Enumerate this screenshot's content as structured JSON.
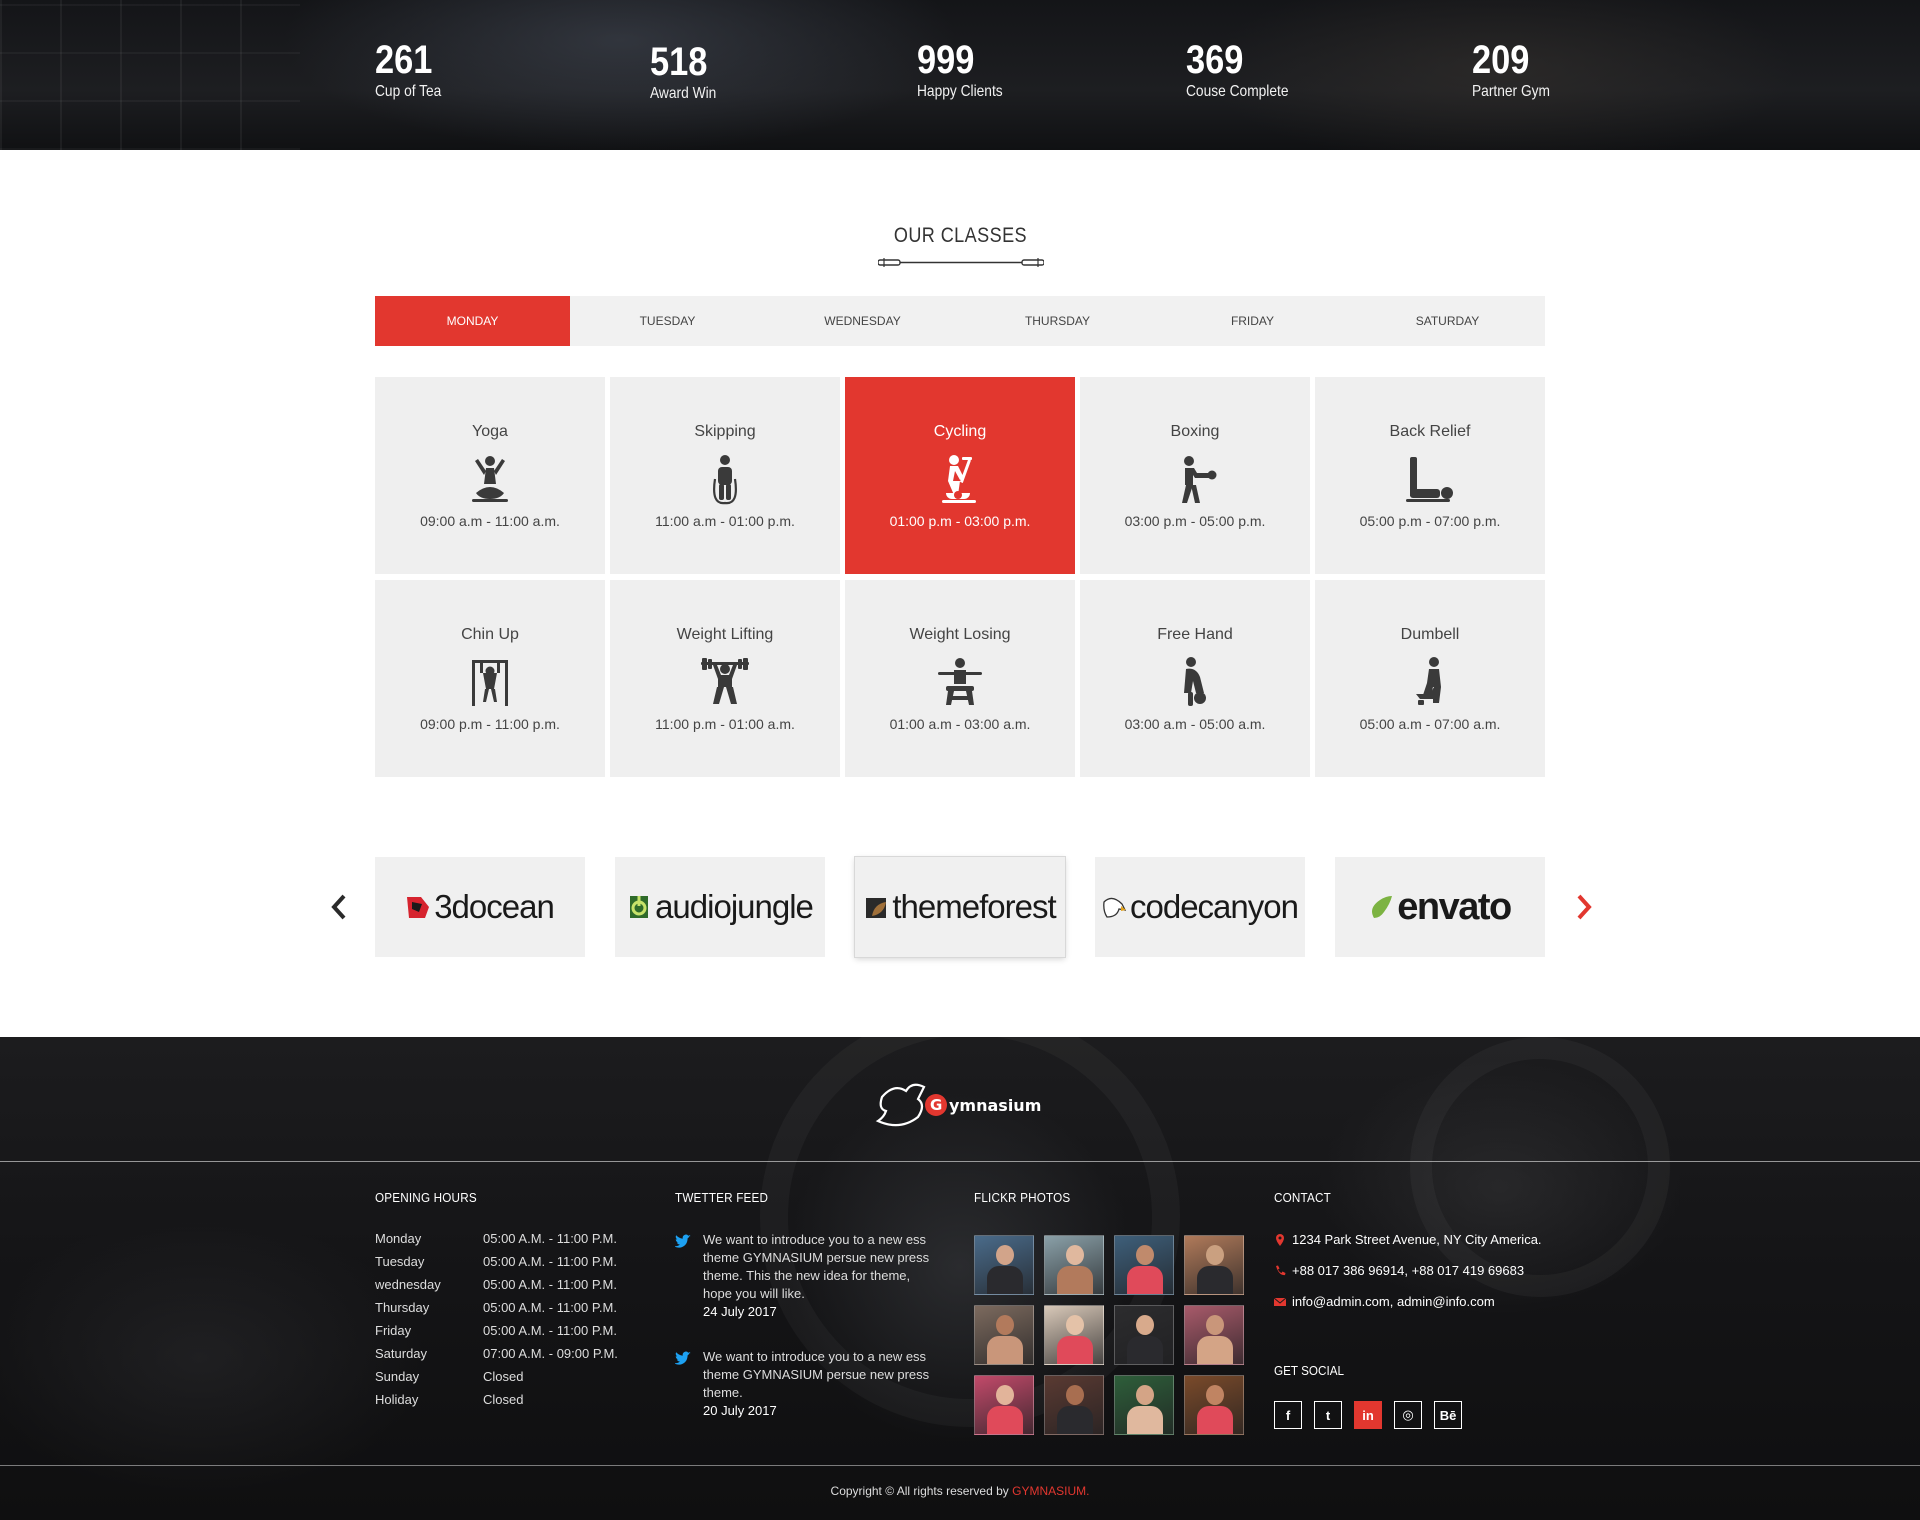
{
  "counters": [
    {
      "number": "261",
      "label": "Cup of Tea"
    },
    {
      "number": "518",
      "label": "Award Win"
    },
    {
      "number": "999",
      "label": "Happy Clients"
    },
    {
      "number": "369",
      "label": "Couse Complete"
    },
    {
      "number": "209",
      "label": "Partner Gym"
    }
  ],
  "classes_section": {
    "title": "OUR CLASSES",
    "tabs": [
      "MONDAY",
      "TUESDAY",
      "WEDNESDAY",
      "THURSDAY",
      "FRIDAY",
      "SATURDAY"
    ],
    "active_tab": "MONDAY",
    "classes": [
      {
        "name": "Yoga",
        "time": "09:00 a.m - 11:00 a.m.",
        "icon": "yoga-icon"
      },
      {
        "name": "Skipping",
        "time": "11:00 a.m - 01:00 p.m.",
        "icon": "skipping-icon"
      },
      {
        "name": "Cycling",
        "time": "01:00 p.m - 03:00 p.m.",
        "icon": "cycling-icon",
        "active": true
      },
      {
        "name": "Boxing",
        "time": "03:00 p.m - 05:00 p.m.",
        "icon": "boxing-icon"
      },
      {
        "name": "Back Relief",
        "time": "05:00 p.m - 07:00 p.m.",
        "icon": "back-relief-icon"
      },
      {
        "name": "Chin Up",
        "time": "09:00 p.m - 11:00 p.m.",
        "icon": "chin-up-icon"
      },
      {
        "name": "Weight Lifting",
        "time": "11:00 p.m - 01:00 a.m.",
        "icon": "weight-lifting-icon"
      },
      {
        "name": "Weight Losing",
        "time": "01:00 a.m - 03:00 a.m.",
        "icon": "weight-losing-icon"
      },
      {
        "name": "Free Hand",
        "time": "03:00 a.m - 05:00 a.m.",
        "icon": "free-hand-icon"
      },
      {
        "name": "Dumbell",
        "time": "05:00 a.m - 07:00 a.m.",
        "icon": "dumbell-icon"
      }
    ]
  },
  "partners": [
    {
      "name": "3docean",
      "color": "#d6232e"
    },
    {
      "name": "audiojungle",
      "color": "#2f6b2a"
    },
    {
      "name": "themeforest",
      "color": "#5c3d22"
    },
    {
      "name": "codecanyon",
      "color": "#ffffff"
    },
    {
      "name": "envato",
      "color": "#7cb342"
    }
  ],
  "footer": {
    "logo_text": "Gymnasium",
    "opening_hours": {
      "title": "OPENING HOURS",
      "rows": [
        {
          "day": "Monday",
          "time": "05:00 A.M. - 11:00 P.M."
        },
        {
          "day": "Tuesday",
          "time": "05:00 A.M. - 11:00 P.M."
        },
        {
          "day": "wednesday",
          "time": "05:00 A.M. - 11:00 P.M."
        },
        {
          "day": "Thursday",
          "time": "05:00 A.M. - 11:00 P.M."
        },
        {
          "day": "Friday",
          "time": "05:00 A.M. - 11:00 P.M."
        },
        {
          "day": "Saturday",
          "time": "07:00 A.M. - 09:00 P.M."
        },
        {
          "day": "Sunday",
          "time": "Closed"
        },
        {
          "day": "Holiday",
          "time": "Closed"
        }
      ]
    },
    "twitter_feed": {
      "title": "TWETTER FEED",
      "tweets": [
        {
          "text": "We want to introduce you to a new ess theme GYMNASIUM persue new press theme. This the new idea for theme, hope you will like.",
          "date": "24 July 2017"
        },
        {
          "text": "We want to introduce you to a new ess theme GYMNASIUM persue new press theme.",
          "date": "20 July 2017"
        }
      ]
    },
    "flickr": {
      "title": "FLICKR PHOTOS",
      "photo_colors": [
        "#4a6b8a",
        "#8aa0a8",
        "#3e5f7a",
        "#b07a5a",
        "#7c6a5e",
        "#d8c8b8",
        "#2c2c2e",
        "#a85a6a",
        "#c24a6a",
        "#5a3a32",
        "#2e5e3a",
        "#7a4a2a"
      ]
    },
    "contact": {
      "title": "CONTACT",
      "address": "1234 Park Street Avenue, NY City America.",
      "phone": "+88 017 386 96914, +88 017 419 69683",
      "email": "info@admin.com, admin@info.com"
    },
    "get_social": {
      "title": "GET SOCIAL",
      "items": [
        {
          "label": "f",
          "icon": "facebook-icon"
        },
        {
          "label": "t",
          "icon": "twitter-icon"
        },
        {
          "label": "in",
          "icon": "linkedin-icon",
          "active": true
        },
        {
          "label": "◎",
          "icon": "instagram-icon"
        },
        {
          "label": "Bē",
          "icon": "behance-icon"
        }
      ]
    },
    "copyright_prefix": "Copyright © All rights reserved by ",
    "copyright_brand": "GYMNASIUM."
  },
  "colors": {
    "accent": "#e2372f"
  }
}
